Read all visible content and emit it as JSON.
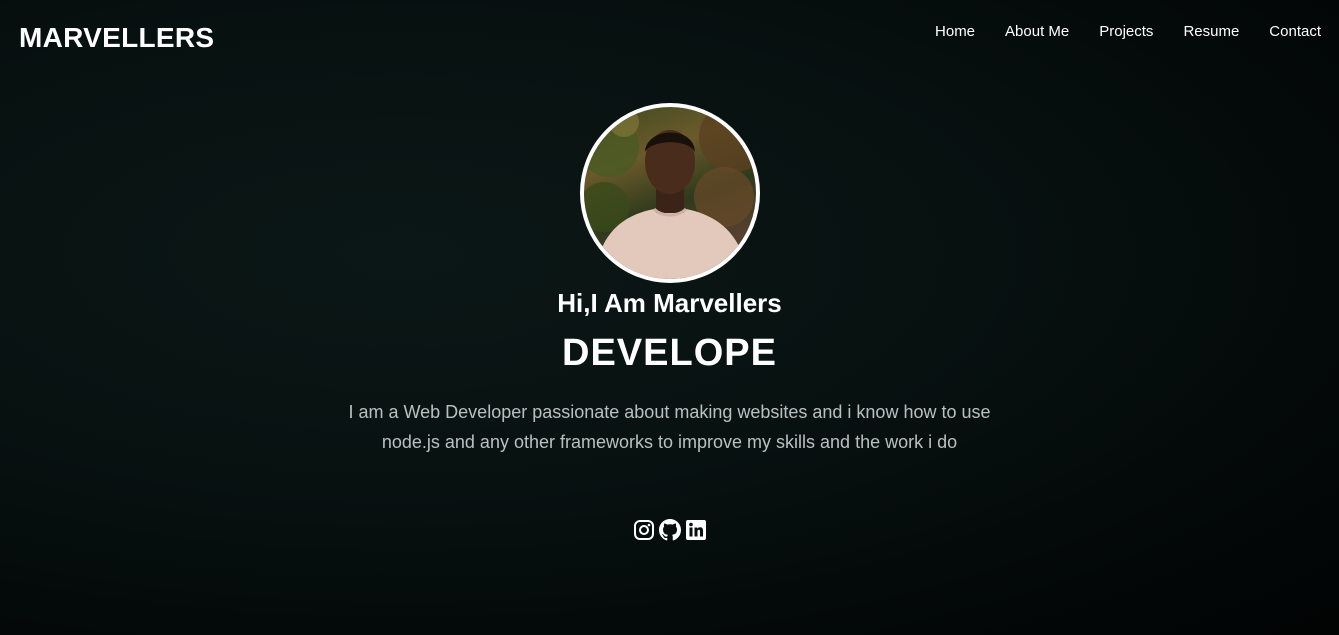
{
  "navbar": {
    "brand": "MARVELLERS",
    "links": [
      "Home",
      "About Me",
      "Projects",
      "Resume",
      "Contact"
    ]
  },
  "hero": {
    "greeting": "Hi,I Am Marvellers",
    "role": "DEVELOPE",
    "bio": "I am a Web Developer passionate about making websites and i know how to use node.js and any other frameworks to improve my skills and the work i do"
  },
  "socials": {
    "icons": [
      "instagram-icon",
      "github-icon",
      "linkedin-icon"
    ]
  },
  "colors": {
    "background": "#061010",
    "text": "#ffffff",
    "muted_text": "#b9c0c0"
  }
}
